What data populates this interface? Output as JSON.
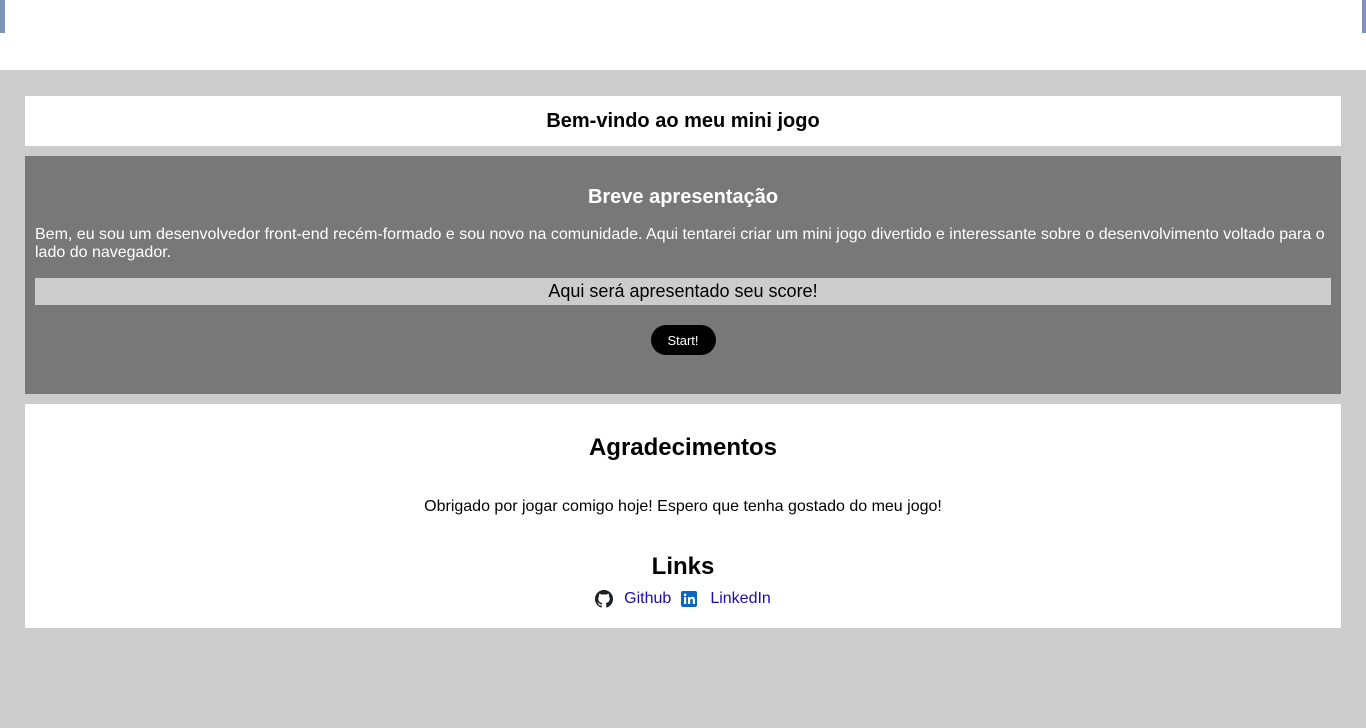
{
  "header": {
    "title": "Bem-vindo ao meu mini jogo"
  },
  "intro": {
    "title": "Breve apresentação",
    "text": "Bem, eu sou um desenvolvedor front-end recém-formado e sou novo na comunidade. Aqui tentarei criar um mini jogo divertido e interessante sobre o desenvolvimento voltado para o lado do navegador.",
    "score_text": "Aqui será apresentado seu score!",
    "start_label": "Start!"
  },
  "thanks": {
    "title": "Agradecimentos",
    "text": "Obrigado por jogar comigo hoje! Espero que tenha gostado do meu jogo!"
  },
  "links": {
    "title": "Links",
    "items": [
      {
        "label": "Github",
        "icon": "github-icon"
      },
      {
        "label": "LinkedIn",
        "icon": "linkedin-icon"
      }
    ]
  },
  "colors": {
    "page_bg": "#cccccc",
    "intro_bg": "#787878",
    "link": "#1a0dab",
    "linkedin": "#0a66c2"
  }
}
